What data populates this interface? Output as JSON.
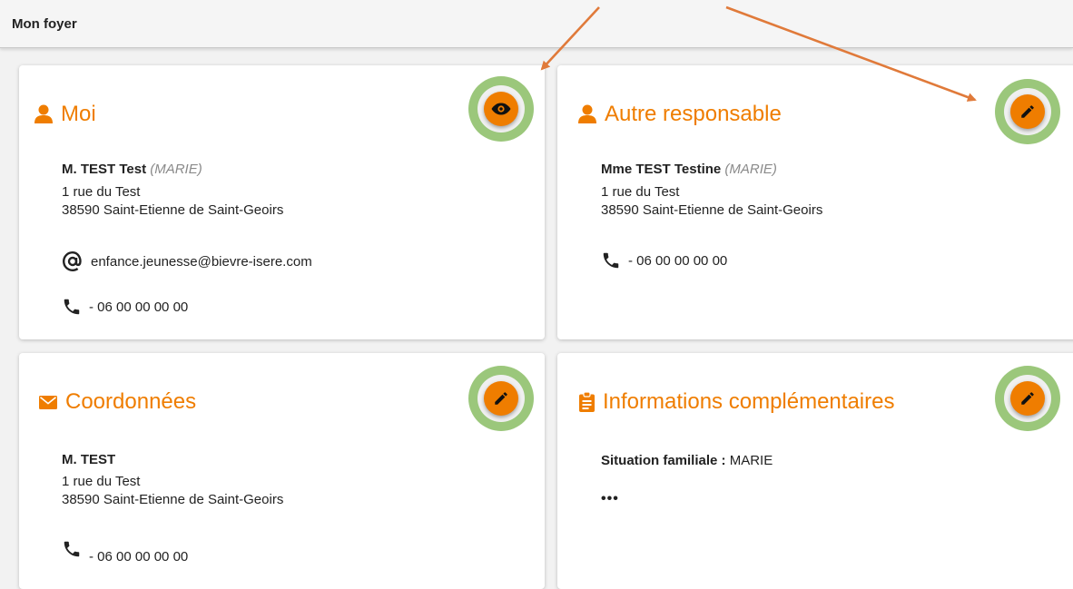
{
  "page": {
    "title": "Mon foyer"
  },
  "accent_color": "#ef7d00",
  "highlight_color": "#9bc77b",
  "cards": {
    "moi": {
      "title": "Moi",
      "icon": "person-icon",
      "action_icon": "eye-icon",
      "name": "M. TEST Test",
      "status": "(MARIE)",
      "address_line1": "1 rue du Test",
      "address_line2": "38590 Saint-Etienne de Saint-Geoirs",
      "email": "enfance.jeunesse@bievre-isere.com",
      "phone": "- 06 00 00 00 00"
    },
    "autre": {
      "title": "Autre responsable",
      "icon": "person-icon",
      "action_icon": "pencil-icon",
      "name": "Mme TEST Testine",
      "status": "(MARIE)",
      "address_line1": "1 rue du Test",
      "address_line2": "38590 Saint-Etienne de Saint-Geoirs",
      "phone": "- 06 00 00 00 00"
    },
    "coordonnees": {
      "title": "Coordonnées",
      "icon": "envelope-icon",
      "action_icon": "pencil-icon",
      "name": "M. TEST",
      "address_line1": "1 rue du Test",
      "address_line2": "38590 Saint-Etienne de Saint-Geoirs",
      "phone": "- 06 00 00 00 00"
    },
    "infos": {
      "title": "Informations complémentaires",
      "icon": "clipboard-icon",
      "action_icon": "pencil-icon",
      "situation_label": "Situation familiale :",
      "situation_value": "MARIE",
      "more": "•••"
    }
  }
}
